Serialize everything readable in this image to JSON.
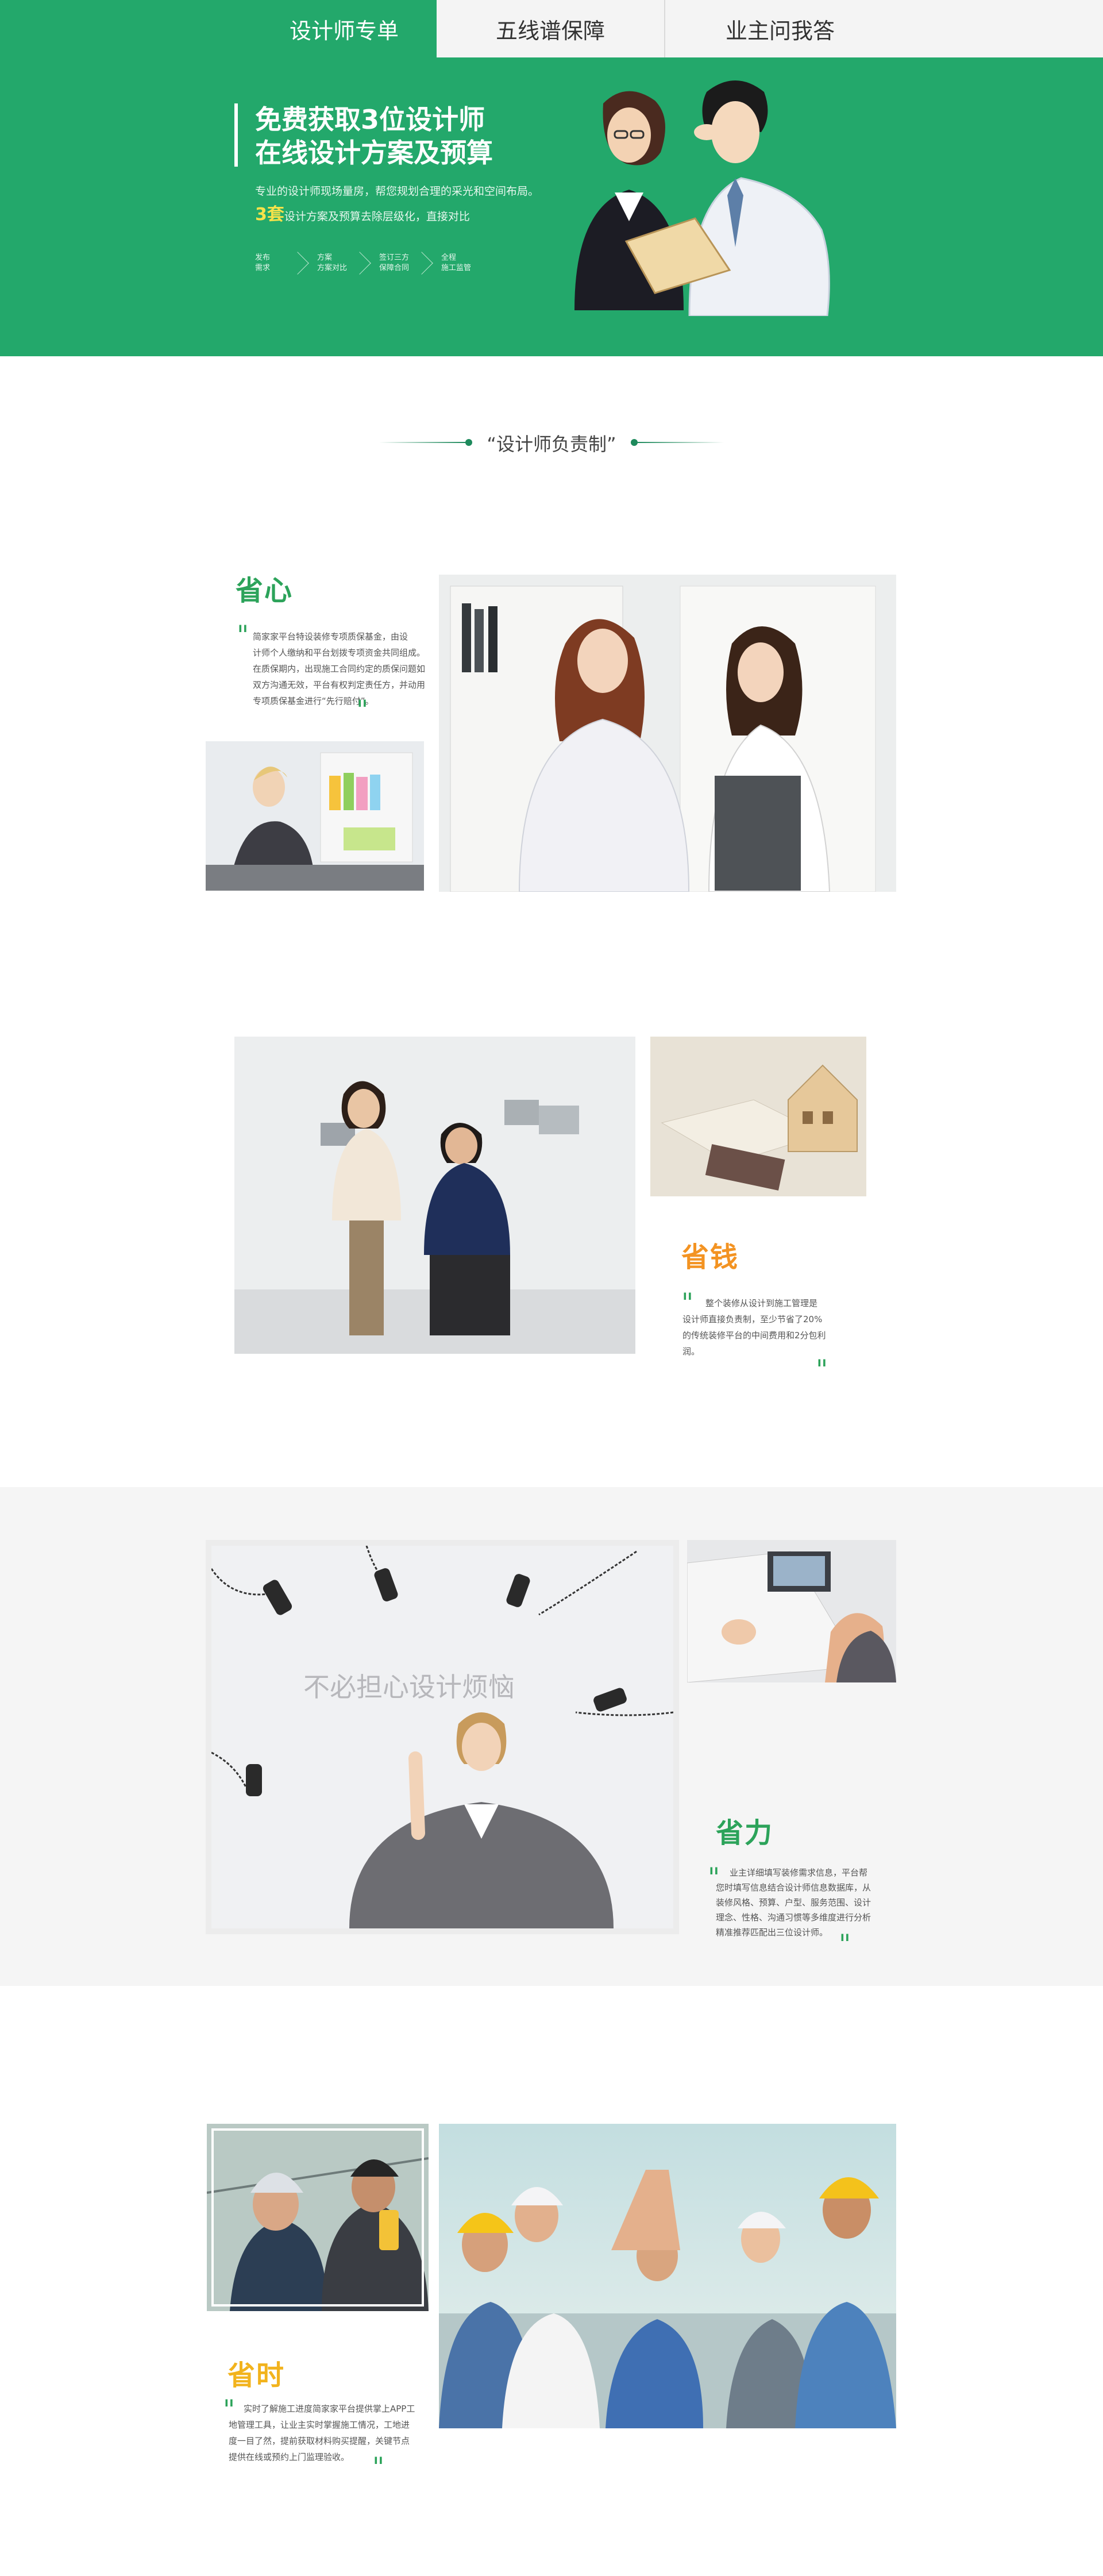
{
  "tabs": [
    {
      "label": "设计师专单",
      "active": true
    },
    {
      "label": "五线谱保障",
      "active": false
    },
    {
      "label": "业主问我答",
      "active": false
    }
  ],
  "hero": {
    "title_line1": "免费获取3位设计师",
    "title_line2": "在线设计方案及预算",
    "desc_line1": "专业的设计师现场量房，帮您规划合理的采光和空间布局。",
    "desc_line2_highlight": "3套",
    "desc_line2_rest": "设计方案及预算去除层级化，直接对比",
    "steps": [
      {
        "line1": "发布",
        "line2": "需求"
      },
      {
        "line1": "方案",
        "line2": "方案对比"
      },
      {
        "line1": "签订三方",
        "line2": "保障合同"
      },
      {
        "line1": "全程",
        "line2": "施工监管"
      }
    ]
  },
  "section": {
    "title": "“设计师负责制”"
  },
  "features": {
    "f1": {
      "title": "省心",
      "text": [
        "简家家平台特设装修专项质保基金，由设",
        "计师个人缴纳和平台划拨专项资金共同组成。",
        "在质保期内，出现施工合同约定的质保问题如",
        "双方沟通无效，平台有权判定责任方，并动用",
        "专项质保基金进行“先行赔付”。"
      ]
    },
    "f2": {
      "title": "省钱",
      "text": [
        "整个装修从设计到施工管理是",
        "设计师直接负责制，至少节省了20%",
        "的传统装修平台的中间费用和2分包利",
        "润。"
      ]
    },
    "f3": {
      "title": "省力",
      "image_caption": "不必担心设计烦恼",
      "text": [
        "业主详细填写装修需求信息，平台帮",
        "您时填写信息结合设计师信息数据库，从",
        "装修风格、预算、户型、服务范围、设计",
        "理念、性格、沟通习惯等多维度进行分析",
        "精准推荐匹配出三位设计师。"
      ]
    },
    "f4": {
      "title": "省时",
      "text": [
        "实时了解施工进度简家家平台提供掌上APP工",
        "地管理工具，让业主实时掌握施工情况，工地进",
        "度一目了然，提前获取材料购买提醒，关键节点",
        "提供在线或预约上门监理验收。"
      ]
    }
  },
  "colors": {
    "brand_green": "#23a86b",
    "title_green": "#2ca35a",
    "title_orange": "#f39322",
    "title_yellow": "#f2b31d"
  }
}
